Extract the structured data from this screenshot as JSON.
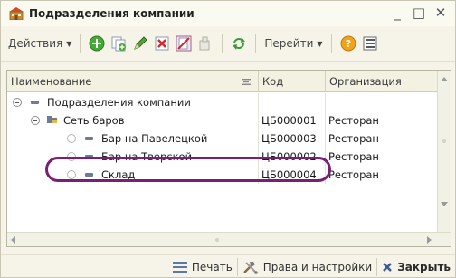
{
  "window": {
    "title": "Подразделения компании",
    "minimize_glyph": "_",
    "maximize_glyph": "□",
    "close_glyph": "✕"
  },
  "toolbar": {
    "actions_label": "Действия",
    "goto_label": "Перейти",
    "icons": [
      "add-icon",
      "copy-icon",
      "edit-icon",
      "delete-icon",
      "mark-delete-icon",
      "hierarchy-icon",
      "refresh-icon",
      "help-icon",
      "settings-list-icon"
    ]
  },
  "table": {
    "columns": [
      "Наименование",
      "Код",
      "Организация"
    ],
    "rows": [
      {
        "name": "Подразделения компании",
        "code": "",
        "org": "",
        "level": 0,
        "kind": "root"
      },
      {
        "name": "Сеть баров",
        "code": "ЦБ000001",
        "org": "Ресторан",
        "level": 1,
        "kind": "group"
      },
      {
        "name": "Бар на Павелецкой",
        "code": "ЦБ000003",
        "org": "Ресторан",
        "level": 2,
        "kind": "item"
      },
      {
        "name": "Бар на Тверской",
        "code": "ЦБ000002",
        "org": "Ресторан",
        "level": 2,
        "kind": "item",
        "highlighted": true
      },
      {
        "name": "Склад",
        "code": "ЦБ000004",
        "org": "Ресторан",
        "level": 2,
        "kind": "item"
      }
    ]
  },
  "footer": {
    "print_label": "Печать",
    "rights_label": "Права и настройки",
    "close_label": "Закрыть"
  },
  "colors": {
    "highlight": "#7a1f73",
    "window_bg": "#f6f4e8"
  }
}
